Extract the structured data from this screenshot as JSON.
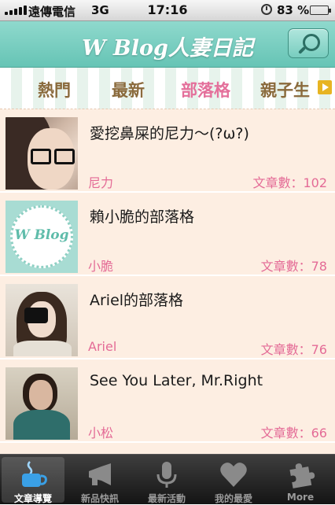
{
  "status": {
    "carrier": "遠傳電信",
    "network": "3G",
    "time": "17:16",
    "battery": "83 %",
    "battery_level": 0.83
  },
  "header": {
    "title": "W Blog人妻日記",
    "search_icon": "search-icon"
  },
  "tabs": [
    {
      "label": "熱門"
    },
    {
      "label": "最新"
    },
    {
      "label": "部落格",
      "active": true
    },
    {
      "label": "親子生"
    }
  ],
  "blogs": [
    {
      "title": "愛挖鼻屎的尼力～(?ω?)",
      "author": "尼力",
      "count": "文章數：102"
    },
    {
      "title": "賴小脆的部落格",
      "author": "小脆",
      "count": "文章數：78",
      "thumb_text": "W Blog"
    },
    {
      "title": "Ariel的部落格",
      "author": "Ariel",
      "count": "文章數：76"
    },
    {
      "title": "See You Later, Mr.Right",
      "author": "小松",
      "count": "文章數：66"
    }
  ],
  "tabbar": [
    {
      "label": "文章導覽",
      "icon": "cup-icon",
      "active": true
    },
    {
      "label": "新品快訊",
      "icon": "megaphone-icon"
    },
    {
      "label": "最新活動",
      "icon": "microphone-icon"
    },
    {
      "label": "我的最愛",
      "icon": "heart-icon"
    },
    {
      "label": "More",
      "icon": "puzzle-icon"
    }
  ],
  "colors": {
    "header": "#66c4b5",
    "accent_pink": "#e46b96",
    "tab_brown": "#8a6a3c",
    "list_bg": "#fdeee2"
  }
}
